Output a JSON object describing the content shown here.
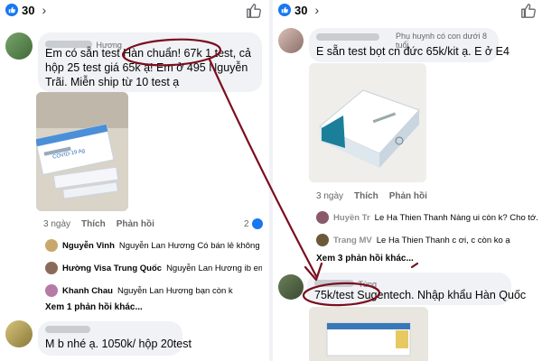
{
  "left": {
    "like_count": "30",
    "comment1": {
      "name": "Hương",
      "text": "Em có sẵn test Hàn chuẩn! 67k 1 test, cả hộp 25 test giá 65k ạ! Em ở 495 Nguyễn Trãi. Miễn ship từ 10 test ạ",
      "photo_caption": "COVID-19 Ag",
      "actions": {
        "time": "3 ngày",
        "like": "Thích",
        "reply": "Phản hồi",
        "reactions": "2"
      },
      "replies": [
        {
          "name": "Nguyễn Vinh",
          "text": "Nguyễn Lan Hương Có bán lẻ không b..."
        },
        {
          "name": "Hường Visa Trung Quốc",
          "text": "Nguyễn Lan Hương ib em"
        },
        {
          "name": "Khanh Chau",
          "text": "Nguyễn Lan Hương bạn còn k"
        }
      ],
      "more_replies": "Xem 1 phản hồi khác..."
    },
    "comment2": {
      "text": "M b nhé ạ. 1050k/ hộp 20test"
    }
  },
  "right": {
    "like_count": "30",
    "comment1": {
      "badge": "Phụ huynh có con dưới 8 tuổi",
      "text": "E sẵn test bọt cn đức 65k/kit ạ. E ở E4",
      "actions": {
        "time": "3 ngày",
        "like": "Thích",
        "reply": "Phản hồi"
      },
      "replies": [
        {
          "name": "Huyền Tr",
          "text": "Le Ha Thien Thanh Nàng ui còn k? Cho tớ..."
        },
        {
          "name": "Trang MV",
          "text": "Le Ha Thien Thanh c ơi, c còn ko ạ"
        }
      ],
      "more_replies": "Xem 3 phản hồi khác..."
    },
    "comment2": {
      "name": "Tùng",
      "text": "75k/test Sugentech. Nhập khẩu Hàn Quốc"
    }
  },
  "colors": {
    "accent": "#1877f2",
    "annotation": "#7a0e1e",
    "bubble": "#f0f2f5"
  },
  "icons": [
    "like-badge-icon",
    "chevron-right-icon",
    "thumbs-up-icon",
    "like-reaction-icon"
  ]
}
